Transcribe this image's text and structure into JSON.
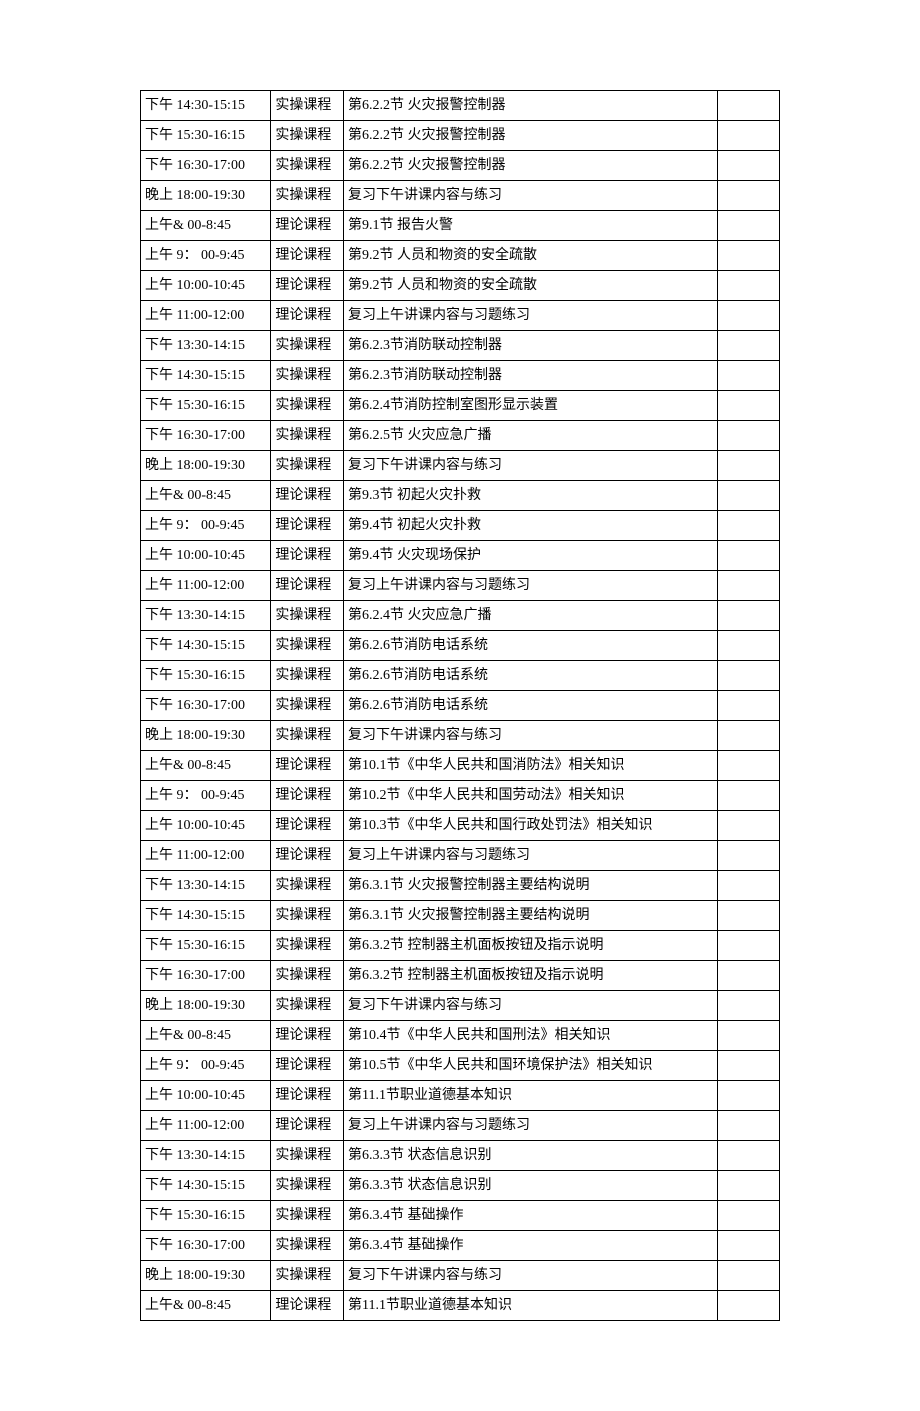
{
  "rows": [
    {
      "time": "下午 14:30-15:15",
      "type": "实操课程",
      "content": "第6.2.2节  火灾报警控制器",
      "note": ""
    },
    {
      "time": "下午 15:30-16:15",
      "type": "实操课程",
      "content": "第6.2.2节  火灾报警控制器",
      "note": ""
    },
    {
      "time": "下午 16:30-17:00",
      "type": "实操课程",
      "content": "第6.2.2节  火灾报警控制器",
      "note": ""
    },
    {
      "time": "晚上 18:00-19:30",
      "type": "实操课程",
      "content": "复习下午讲课内容与练习",
      "note": ""
    },
    {
      "time": "上午& 00-8:45",
      "type": "理论课程",
      "content": "第9.1节 报告火警",
      "note": ""
    },
    {
      "time": "上午 9：  00-9:45",
      "type": "理论课程",
      "content": "第9.2节      人员和物资的安全疏散",
      "note": ""
    },
    {
      "time": "上午 10:00-10:45",
      "type": "理论课程",
      "content": "第9.2节      人员和物资的安全疏散",
      "note": ""
    },
    {
      "time": "上午 11:00-12:00",
      "type": "理论课程",
      "content": "复习上午讲课内容与习题练习",
      "note": ""
    },
    {
      "time": "下午 13:30-14:15",
      "type": "实操课程",
      "content": "第6.2.3节消防联动控制器",
      "note": ""
    },
    {
      "time": "下午 14:30-15:15",
      "type": "实操课程",
      "content": "第6.2.3节消防联动控制器",
      "note": ""
    },
    {
      "time": "下午 15:30-16:15",
      "type": "实操课程",
      "content": "第6.2.4节消防控制室图形显示装置",
      "note": ""
    },
    {
      "time": "下午 16:30-17:00",
      "type": "实操课程",
      "content": "第6.2.5节  火灾应急广播",
      "note": ""
    },
    {
      "time": "晚上 18:00-19:30",
      "type": "实操课程",
      "content": "复习下午讲课内容与练习",
      "note": ""
    },
    {
      "time": "上午& 00-8:45",
      "type": "理论课程",
      "content": "第9.3节  初起火灾扑救",
      "note": ""
    },
    {
      "time": "上午 9：  00-9:45",
      "type": "理论课程",
      "content": "第9.4节  初起火灾扑救",
      "note": ""
    },
    {
      "time": "上午 10:00-10:45",
      "type": "理论课程",
      "content": "第9.4节  火灾现场保护",
      "note": ""
    },
    {
      "time": "上午 11:00-12:00",
      "type": "理论课程",
      "content": "复习上午讲课内容与习题练习",
      "note": ""
    },
    {
      "time": "下午 13:30-14:15",
      "type": "实操课程",
      "content": "第6.2.4节  火灾应急广播",
      "note": ""
    },
    {
      "time": "下午 14:30-15:15",
      "type": "实操课程",
      "content": "第6.2.6节消防电话系统",
      "note": ""
    },
    {
      "time": "下午 15:30-16:15",
      "type": "实操课程",
      "content": "第6.2.6节消防电话系统",
      "note": ""
    },
    {
      "time": "下午 16:30-17:00",
      "type": "实操课程",
      "content": "第6.2.6节消防电话系统",
      "note": ""
    },
    {
      "time": "晚上 18:00-19:30",
      "type": "实操课程",
      "content": "复习下午讲课内容与练习",
      "note": ""
    },
    {
      "time": "上午& 00-8:45",
      "type": "理论课程",
      "content": "第10.1节《中华人民共和国消防法》相关知识",
      "note": ""
    },
    {
      "time": "上午 9：  00-9:45",
      "type": "理论课程",
      "content": "第10.2节《中华人民共和国劳动法》相关知识",
      "note": ""
    },
    {
      "time": "上午 10:00-10:45",
      "type": "理论课程",
      "content": "第10.3节《中华人民共和国行政处罚法》相关知识",
      "note": ""
    },
    {
      "time": "上午 11:00-12:00",
      "type": "理论课程",
      "content": "复习上午讲课内容与习题练习",
      "note": ""
    },
    {
      "time": "下午 13:30-14:15",
      "type": "实操课程",
      "content": "第6.3.1节  火灾报警控制器主要结构说明",
      "note": ""
    },
    {
      "time": "下午 14:30-15:15",
      "type": "实操课程",
      "content": "第6.3.1节  火灾报警控制器主要结构说明",
      "note": ""
    },
    {
      "time": "下午 15:30-16:15",
      "type": "实操课程",
      "content": "第6.3.2节  控制器主机面板按钮及指示说明",
      "note": ""
    },
    {
      "time": "下午 16:30-17:00",
      "type": "实操课程",
      "content": "第6.3.2节  控制器主机面板按钮及指示说明",
      "note": ""
    },
    {
      "time": "晚上 18:00-19:30",
      "type": "实操课程",
      "content": "复习下午讲课内容与练习",
      "note": ""
    },
    {
      "time": "上午& 00-8:45",
      "type": "理论课程",
      "content": "第10.4节《中华人民共和国刑法》相关知识",
      "note": ""
    },
    {
      "time": "上午 9：  00-9:45",
      "type": "理论课程",
      "content": "第10.5节《中华人民共和国环境保护法》相关知识",
      "note": ""
    },
    {
      "time": "上午 10:00-10:45",
      "type": "理论课程",
      "content": "第11.1节职业道德基本知识",
      "note": ""
    },
    {
      "time": "上午 11:00-12:00",
      "type": "理论课程",
      "content": "复习上午讲课内容与习题练习",
      "note": ""
    },
    {
      "time": "下午 13:30-14:15",
      "type": "实操课程",
      "content": "第6.3.3节  状态信息识别",
      "note": ""
    },
    {
      "time": "下午 14:30-15:15",
      "type": "实操课程",
      "content": "第6.3.3节  状态信息识别",
      "note": ""
    },
    {
      "time": "下午 15:30-16:15",
      "type": "实操课程",
      "content": "第6.3.4节  基础操作",
      "note": ""
    },
    {
      "time": "下午 16:30-17:00",
      "type": "实操课程",
      "content": "第6.3.4节  基础操作",
      "note": ""
    },
    {
      "time": "晚上 18:00-19:30",
      "type": "实操课程",
      "content": "复习下午讲课内容与练习",
      "note": ""
    },
    {
      "time": "上午& 00-8:45",
      "type": "理论课程",
      "content": "第11.1节职业道德基本知识",
      "note": ""
    }
  ]
}
